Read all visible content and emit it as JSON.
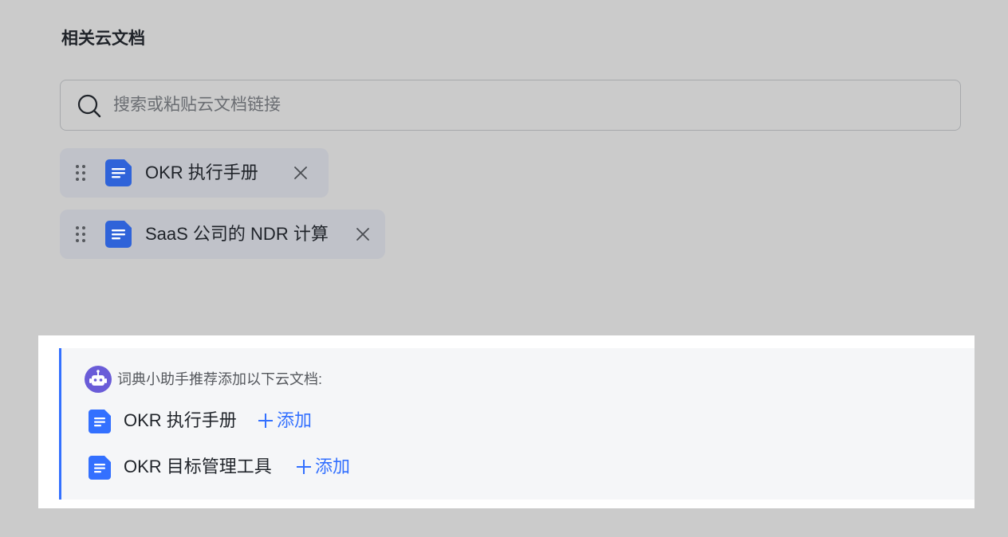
{
  "section": {
    "title": "相关云文档"
  },
  "search": {
    "placeholder": "搜索或粘贴云文档链接",
    "value": ""
  },
  "linked_docs": [
    {
      "title": "OKR 执行手册"
    },
    {
      "title": "SaaS 公司的 NDR 计算"
    }
  ],
  "recommendation": {
    "title": "词典小助手推荐添加以下云文档:",
    "items": [
      {
        "title": "OKR 执行手册",
        "action": "添加"
      },
      {
        "title": "OKR 目标管理工具",
        "action": "添加"
      }
    ]
  },
  "colors": {
    "accent": "#3370ff",
    "doc_icon": "#2f63d9",
    "bot_icon": "#6a5cd8",
    "background": "#cbcbcb",
    "chip": "#c0c2c9"
  },
  "icons": {
    "search": "search-icon",
    "drag": "drag-handle-icon",
    "document": "document-icon",
    "close": "close-icon",
    "bot": "robot-icon",
    "plus": "plus-icon"
  }
}
